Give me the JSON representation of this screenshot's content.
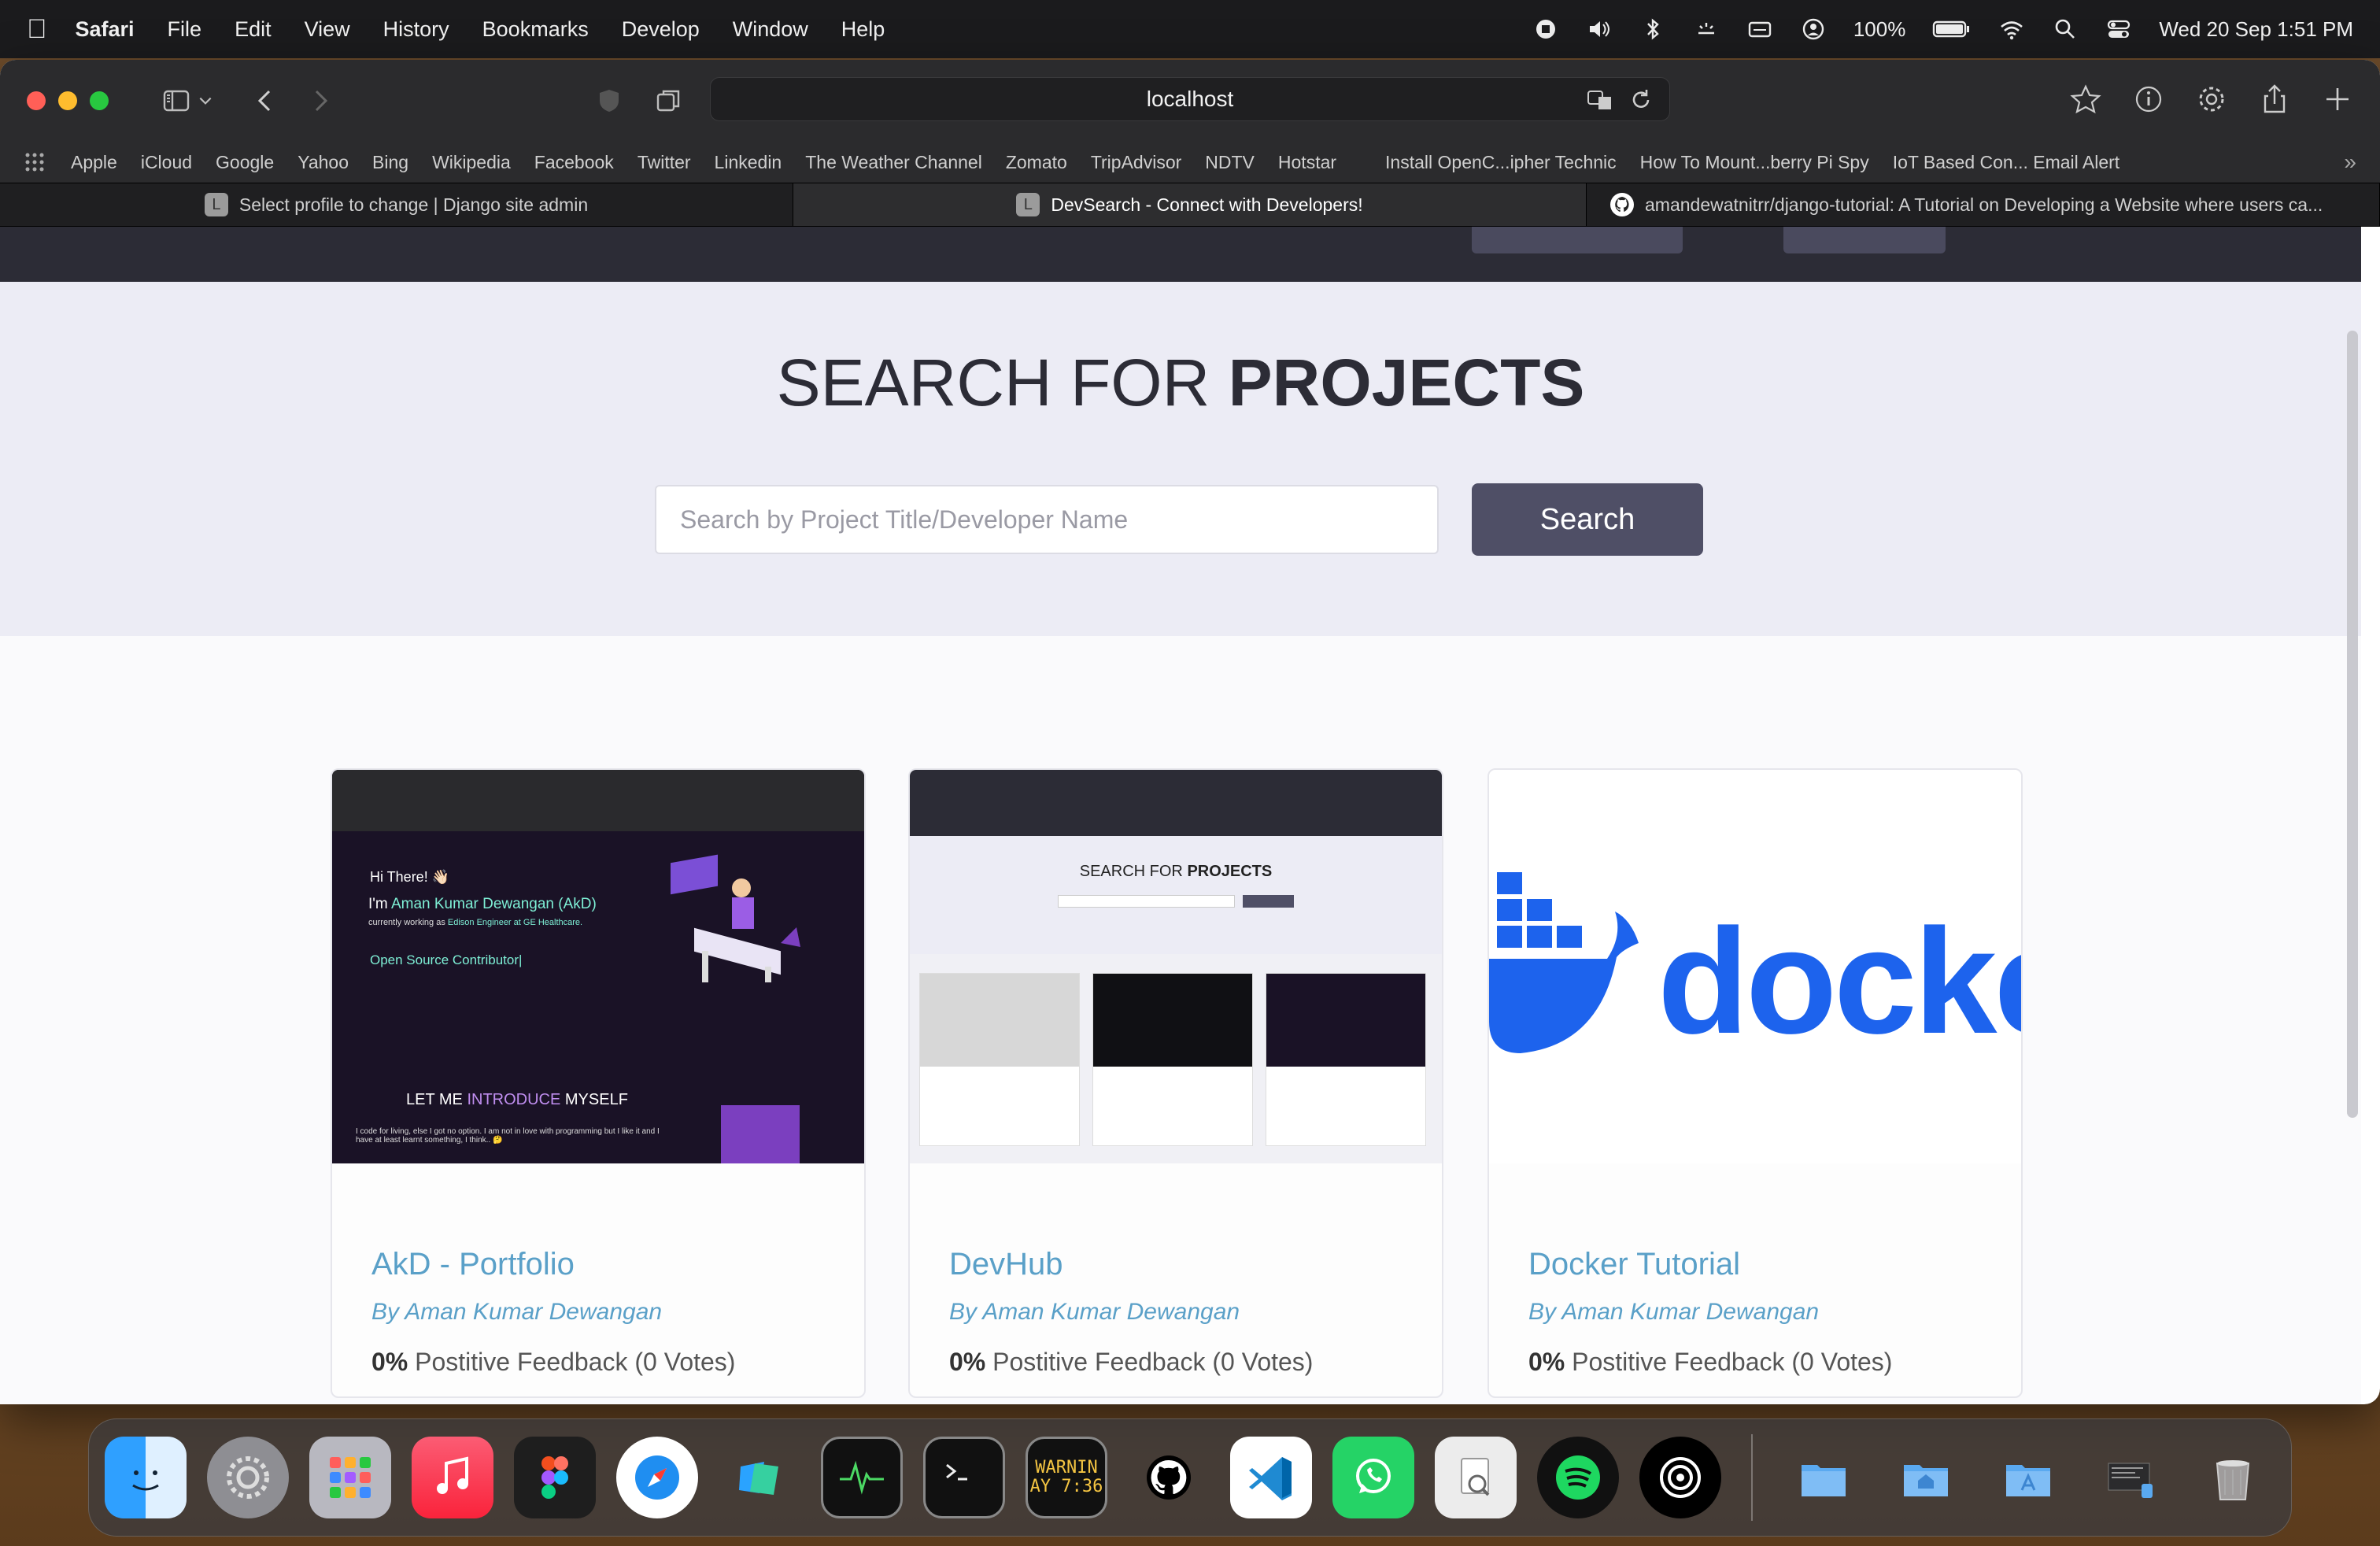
{
  "menubar": {
    "app": "Safari",
    "menus": [
      "File",
      "Edit",
      "View",
      "History",
      "Bookmarks",
      "Develop",
      "Window",
      "Help"
    ],
    "battery": "100%",
    "datetime": "Wed 20 Sep  1:51 PM"
  },
  "toolbar": {
    "address": "localhost"
  },
  "bookmarks": [
    "Apple",
    "iCloud",
    "Google",
    "Yahoo",
    "Bing",
    "Wikipedia",
    "Facebook",
    "Twitter",
    "Linkedin",
    "The Weather Channel",
    "Zomato",
    "TripAdvisor",
    "NDTV",
    "Hotstar",
    "Install OpenC...ipher Technic",
    "How To Mount...berry Pi Spy",
    "IoT Based Con... Email Alert"
  ],
  "tabs": [
    {
      "label": "Select profile to change | Django site admin",
      "fav": "L",
      "active": false
    },
    {
      "label": "DevSearch - Connect with Developers!",
      "fav": "L",
      "active": true
    },
    {
      "label": "amandewatnitrr/django-tutorial: A Tutorial on Developing a Website where users ca...",
      "fav": "",
      "active": false
    }
  ],
  "hero": {
    "title_light": "SEARCH FOR ",
    "title_bold": "PROJECTS",
    "search_placeholder": "Search by Project Title/Developer Name",
    "search_button": "Search"
  },
  "projects": [
    {
      "title": "AkD - Portfolio",
      "author": "By Aman Kumar Dewangan",
      "feedback_pct": "0%",
      "feedback_text": " Postitive Feedback (0 Votes)",
      "thumb": {
        "hi": "Hi There! 👋🏻",
        "im_prefix": "I'm ",
        "name": "Aman Kumar Dewangan (AkD)",
        "cw_prefix": "currently working as ",
        "role": "Edison Engineer at GE Healthcare.",
        "osc": "Open Source Contributor|",
        "intro_a": "LET ME ",
        "intro_b": "INTRODUCE",
        "intro_c": " MYSELF",
        "para": "I code for living, else I got no option. I am not in love with programming but I like it and I have at least learnt something, I think.. 🤔"
      }
    },
    {
      "title": "DevHub",
      "author": "By Aman Kumar Dewangan",
      "feedback_pct": "0%",
      "feedback_text": " Postitive Feedback (0 Votes)",
      "thumb": {
        "heading_light": "SEARCH FOR ",
        "heading_bold": "PROJECTS"
      }
    },
    {
      "title": "Docker Tutorial",
      "author": "By Aman Kumar Dewangan",
      "feedback_pct": "0%",
      "feedback_text": " Postitive Feedback (0 Votes)",
      "thumb": {
        "logo_text": "docke"
      }
    }
  ],
  "dock": {
    "items": [
      "Finder",
      "System Settings",
      "Launchpad",
      "Music",
      "Figma",
      "Safari",
      "Screens",
      "Activity Monitor",
      "Terminal",
      "Console",
      "GitHub Desktop",
      "Visual Studio Code",
      "WhatsApp",
      "Preview",
      "Spotify",
      "Notchmeister",
      "Folder",
      "Home Folder",
      "Applications",
      "Screenshot",
      "Trash"
    ],
    "console_text": "WARNIN\nAY 7:36"
  },
  "colors": {
    "accent_blue": "#5aa0c8",
    "search_button": "#4f4f66",
    "hero_bg": "#ececf5",
    "docker_blue": "#1d63ed"
  }
}
